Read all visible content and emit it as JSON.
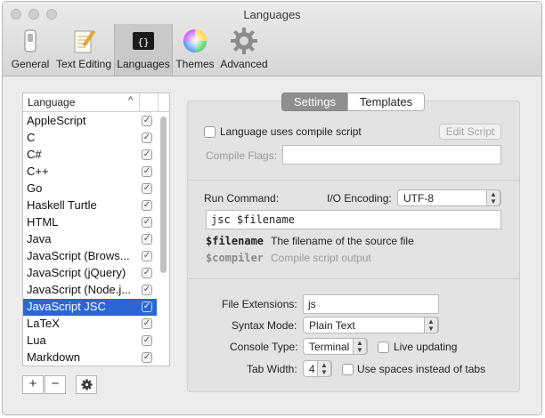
{
  "window": {
    "title": "Languages"
  },
  "toolbar": {
    "items": [
      {
        "label": "General"
      },
      {
        "label": "Text Editing"
      },
      {
        "label": "Languages"
      },
      {
        "label": "Themes"
      },
      {
        "label": "Advanced"
      }
    ],
    "selected": "Languages"
  },
  "list": {
    "header": "Language",
    "rows": [
      {
        "name": "AppleScript",
        "checked": true
      },
      {
        "name": "C",
        "checked": true
      },
      {
        "name": "C#",
        "checked": true
      },
      {
        "name": "C++",
        "checked": true
      },
      {
        "name": "Go",
        "checked": true
      },
      {
        "name": "Haskell Turtle",
        "checked": true
      },
      {
        "name": "HTML",
        "checked": true
      },
      {
        "name": "Java",
        "checked": true
      },
      {
        "name": "JavaScript (Brows...",
        "checked": true
      },
      {
        "name": "JavaScript (jQuery)",
        "checked": true
      },
      {
        "name": "JavaScript (Node.j...",
        "checked": true
      },
      {
        "name": "JavaScript JSC",
        "checked": true
      },
      {
        "name": "LaTeX",
        "checked": true
      },
      {
        "name": "Lua",
        "checked": true
      },
      {
        "name": "Markdown",
        "checked": true
      }
    ],
    "selected_index": 11,
    "add_label": "+",
    "remove_label": "−"
  },
  "tabs": {
    "settings": "Settings",
    "templates": "Templates",
    "active": "Settings"
  },
  "compile": {
    "uses_compile_label": "Language uses compile script",
    "uses_compile_checked": false,
    "edit_script_label": "Edit Script",
    "flags_label": "Compile Flags:",
    "flags_value": ""
  },
  "run": {
    "command_label": "Run Command:",
    "encoding_label": "I/O Encoding:",
    "encoding_value": "UTF-8",
    "command_value": "jsc $filename",
    "filename_token": "$filename",
    "filename_desc": "The filename of the source file",
    "compiler_token": "$compiler",
    "compiler_desc": "Compile script output"
  },
  "file": {
    "extensions_label": "File Extensions:",
    "extensions_value": "js",
    "syntax_label": "Syntax Mode:",
    "syntax_value": "Plain Text",
    "console_label": "Console Type:",
    "console_value": "Terminal",
    "live_label": "Live updating",
    "live_checked": false,
    "tab_label": "Tab Width:",
    "tab_value": "4",
    "spaces_label": "Use spaces instead of tabs",
    "spaces_checked": false
  }
}
